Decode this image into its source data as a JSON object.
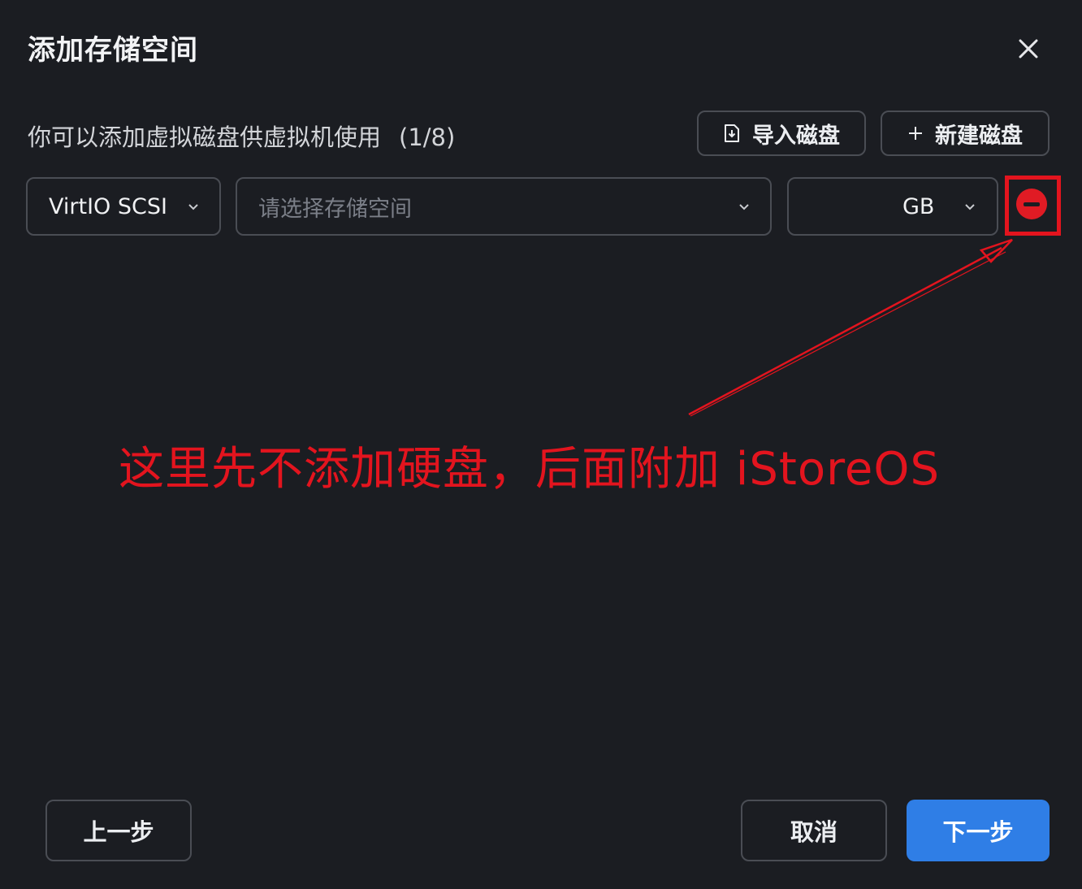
{
  "dialog": {
    "title": "添加存储空间",
    "close_icon": "close-icon"
  },
  "toolbar": {
    "description": "你可以添加虚拟磁盘供虚拟机使用",
    "count": "(1/8)",
    "import_label": "导入磁盘",
    "import_icon": "file-import-icon",
    "new_label": "新建磁盘",
    "new_icon": "plus-icon"
  },
  "disk_row": {
    "bus_value": "VirtIO SCSI",
    "storage_placeholder": "请选择存储空间",
    "size_value": "",
    "size_unit": "GB",
    "remove_icon": "minus-circle-icon"
  },
  "annotation": {
    "text": "这里先不添加硬盘，后面附加 iStoreOS",
    "color": "#e3141e"
  },
  "footer": {
    "prev_label": "上一步",
    "cancel_label": "取消",
    "next_label": "下一步",
    "primary_color": "#2f7ee6"
  }
}
